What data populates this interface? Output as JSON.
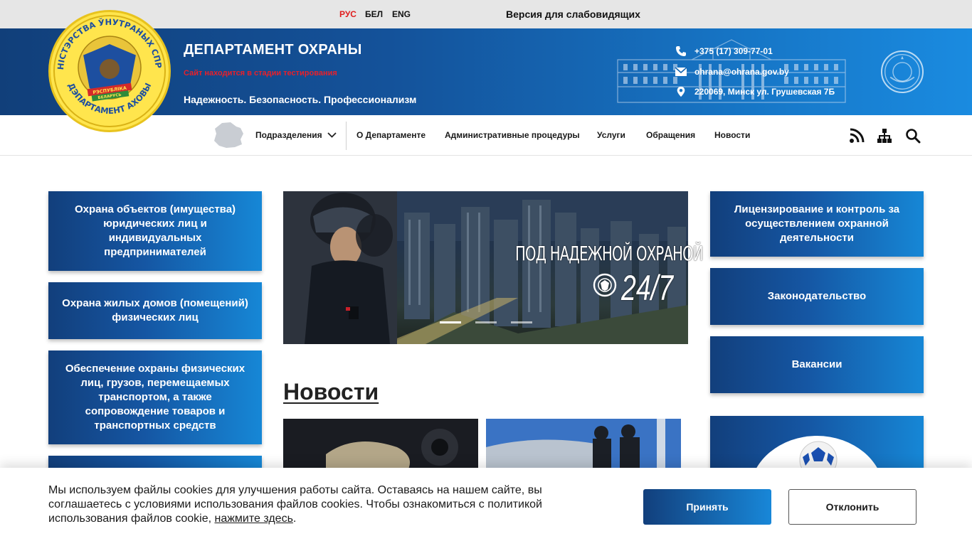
{
  "topbar": {
    "languages": [
      {
        "label": "РУС",
        "active": true
      },
      {
        "label": "БЕЛ",
        "active": false
      },
      {
        "label": "ENG",
        "active": false
      }
    ],
    "vision_label": "Версия для слабовидящих"
  },
  "header": {
    "emblem_texts": {
      "top": "МІНІСТЭРСТВА ЎНУТРАНЫХ СПРАЎ",
      "bottom": "ДЭПАРТАМЕНТ АХОВЫ",
      "ribbon_1": "РЭСПУБЛІКА",
      "ribbon_2": "БЕЛАРУСЬ"
    },
    "title": "ДЕПАРТАМЕНТ ОХРАНЫ",
    "test_notice": "Сайт находится в стадии тестирования",
    "slogan": "Надежность. Безопасность. Профессионализм",
    "phone": "+375 (17) 309-77-01",
    "email": "ohrana@ohrana.gov.by",
    "address": "220069, Минск ул. Грушевская 7Б"
  },
  "nav": {
    "items": [
      {
        "label": "Подразделения",
        "dropdown": true
      },
      {
        "label": "О Департаменте"
      },
      {
        "label": "Административные процедуры"
      },
      {
        "label": "Услуги"
      },
      {
        "label": "Обращения"
      },
      {
        "label": "Новости"
      }
    ],
    "icons": [
      "rss-icon",
      "sitemap-icon",
      "search-icon"
    ]
  },
  "left_menu": [
    "Охрана объектов (имущества) юридических лиц и индивидуальных предпринимателей",
    "Охрана жилых домов (помещений) физических лиц",
    "Обеспечение охраны физических лиц, грузов, перемещаемых транспортом, а также сопровождение товаров и транспортных средств"
  ],
  "slider": {
    "caption": "ПОД НАДЕЖНОЙ ОХРАНОЙ",
    "caption_big": "24/7",
    "slides_count": 3,
    "active_slide": 1
  },
  "news": {
    "heading": "Новости"
  },
  "right_menu": [
    "Лицензирование и контроль за осуществлением охранной деятельности",
    "Законодательство",
    "Вакансии"
  ],
  "cookie": {
    "text": "Мы используем файлы cookies для улучшения работы сайта. Оставаясь на нашем сайте, вы соглашаетесь с условиями использования файлов cookies. Чтобы ознакомиться с политикой использования файлов cookie, ",
    "link": "нажмите здесь",
    "text_end": ".",
    "accept": "Принять",
    "decline": "Отклонить"
  },
  "colors": {
    "brand_dark": "#123f7c",
    "brand_light": "#1887d8",
    "alert": "#e01e1e",
    "emblem_gold": "#ffe54d"
  }
}
